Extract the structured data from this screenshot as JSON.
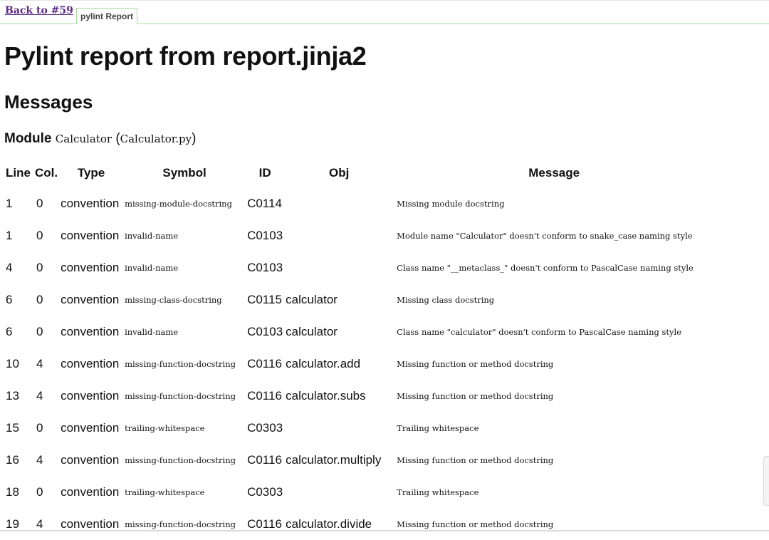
{
  "nav": {
    "back_label": "Back to #59",
    "tab_label": "pylint Report"
  },
  "page": {
    "title": "Pylint report from report.jinja2",
    "messages_heading": "Messages",
    "module_label": "Module",
    "module_name": "Calculator",
    "module_file": "Calculator.py"
  },
  "table": {
    "headers": [
      "Line",
      "Col.",
      "Type",
      "Symbol",
      "ID",
      "Obj",
      "Message"
    ],
    "rows": [
      {
        "line": "1",
        "col": "0",
        "type": "convention",
        "symbol": "missing-module-docstring",
        "id": "C0114",
        "obj": "",
        "message": "Missing module docstring"
      },
      {
        "line": "1",
        "col": "0",
        "type": "convention",
        "symbol": "invalid-name",
        "id": "C0103",
        "obj": "",
        "message": "Module name \"Calculator\" doesn't conform to snake_case naming style"
      },
      {
        "line": "4",
        "col": "0",
        "type": "convention",
        "symbol": "invalid-name",
        "id": "C0103",
        "obj": "",
        "message": "Class name \"__metaclass_\" doesn't conform to PascalCase naming style"
      },
      {
        "line": "6",
        "col": "0",
        "type": "convention",
        "symbol": "missing-class-docstring",
        "id": "C0115",
        "obj": "calculator",
        "message": "Missing class docstring"
      },
      {
        "line": "6",
        "col": "0",
        "type": "convention",
        "symbol": "invalid-name",
        "id": "C0103",
        "obj": "calculator",
        "message": "Class name \"calculator\" doesn't conform to PascalCase naming style"
      },
      {
        "line": "10",
        "col": "4",
        "type": "convention",
        "symbol": "missing-function-docstring",
        "id": "C0116",
        "obj": "calculator.add",
        "message": "Missing function or method docstring"
      },
      {
        "line": "13",
        "col": "4",
        "type": "convention",
        "symbol": "missing-function-docstring",
        "id": "C0116",
        "obj": "calculator.subs",
        "message": "Missing function or method docstring"
      },
      {
        "line": "15",
        "col": "0",
        "type": "convention",
        "symbol": "trailing-whitespace",
        "id": "C0303",
        "obj": "",
        "message": "Trailing whitespace"
      },
      {
        "line": "16",
        "col": "4",
        "type": "convention",
        "symbol": "missing-function-docstring",
        "id": "C0116",
        "obj": "calculator.multiply",
        "message": "Missing function or method docstring"
      },
      {
        "line": "18",
        "col": "0",
        "type": "convention",
        "symbol": "trailing-whitespace",
        "id": "C0303",
        "obj": "",
        "message": "Trailing whitespace"
      },
      {
        "line": "19",
        "col": "4",
        "type": "convention",
        "symbol": "missing-function-docstring",
        "id": "C0116",
        "obj": "calculator.divide",
        "message": "Missing function or method docstring"
      }
    ]
  },
  "colors": {
    "link": "#5b2a86",
    "tab_border": "#a9d9a0"
  }
}
